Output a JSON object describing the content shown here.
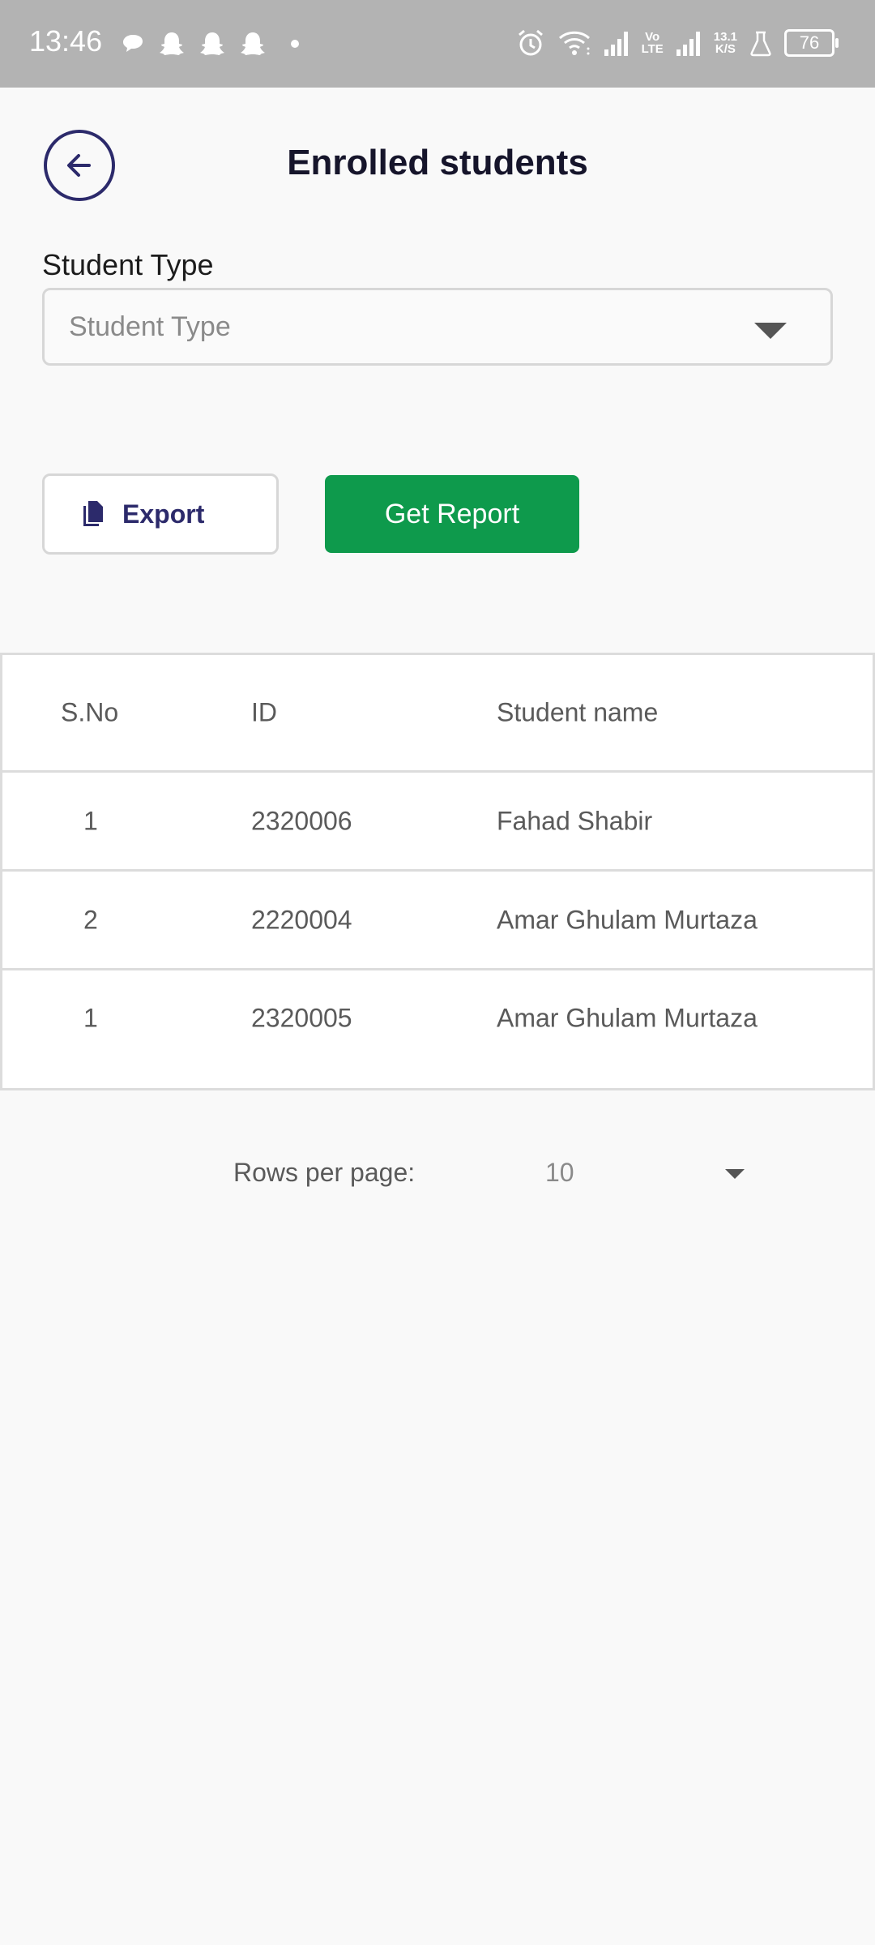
{
  "status_bar": {
    "time": "13:46",
    "net_speed_top": "13.1",
    "net_speed_bottom": "K/S",
    "volte_top": "Vo",
    "volte_bottom": "LTE",
    "battery": "76",
    "icons": [
      "chat-icon",
      "snapchat-icon",
      "snapchat-icon",
      "snapchat-icon",
      "dot-icon",
      "alarm-icon",
      "wifi-icon",
      "signal-icon",
      "signal-icon",
      "flask-icon",
      "battery-icon"
    ]
  },
  "header": {
    "title": "Enrolled students",
    "back_icon": "arrow-left-icon"
  },
  "filter": {
    "label": "Student Type",
    "placeholder": "Student Type"
  },
  "actions": {
    "export_label": "Export",
    "report_label": "Get Report"
  },
  "table": {
    "columns": [
      "S.No",
      "ID",
      "Student name"
    ],
    "rows": [
      {
        "sno": "1",
        "id": "2320006",
        "name": "Fahad Shabir"
      },
      {
        "sno": "2",
        "id": "2220004",
        "name": "Amar Ghulam Murtaza"
      },
      {
        "sno": "1",
        "id": "2320005",
        "name": "Amar Ghulam Murtaza"
      }
    ]
  },
  "pagination": {
    "rows_per_page_label": "Rows per page:",
    "rows_per_page_value": "10"
  },
  "colors": {
    "accent": "#2c2a6b",
    "primary_button": "#0e9a4c",
    "status_bar": "#b3b3b3"
  }
}
